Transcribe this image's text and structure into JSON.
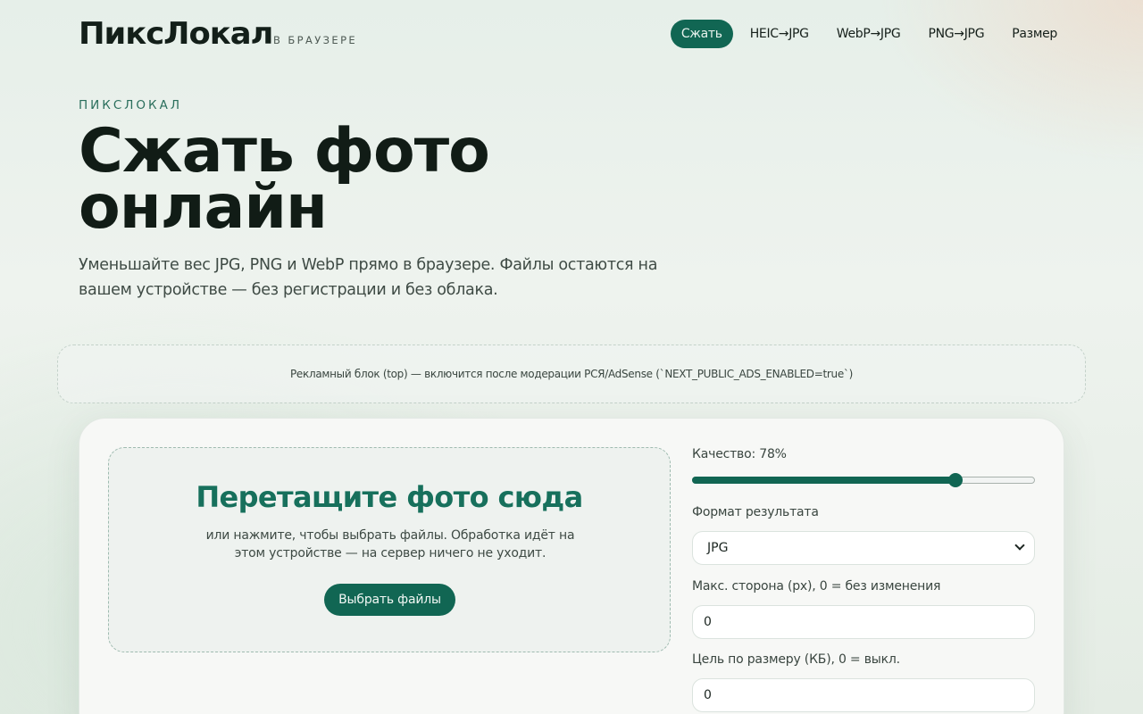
{
  "header": {
    "logo": "ПиксЛокал",
    "logo_sub": "В БРАУЗЕРЕ",
    "nav": [
      {
        "label": "Сжать",
        "active": true
      },
      {
        "label": "HEIC→JPG",
        "active": false
      },
      {
        "label": "WebP→JPG",
        "active": false
      },
      {
        "label": "PNG→JPG",
        "active": false
      },
      {
        "label": "Размер",
        "active": false
      }
    ]
  },
  "hero": {
    "eyebrow": "ПИКСЛОКАЛ",
    "title": "Сжать фото онлайн",
    "subtitle": "Уменьшайте вес JPG, PNG и WebP прямо в браузере. Файлы остаются на вашем устройстве — без регистрации и без облака."
  },
  "ad": {
    "text": "Рекламный блок (top) — включится после модерации РСЯ/AdSense (`NEXT_PUBLIC_ADS_ENABLED=true`)"
  },
  "dropzone": {
    "title": "Перетащите фото сюда",
    "subtitle": "или нажмите, чтобы выбрать файлы. Обработка идёт на этом устройстве — на сервер ничего не уходит.",
    "button": "Выбрать файлы"
  },
  "controls": {
    "quality_label": "Качество: 78%",
    "quality_value": 78,
    "format_label": "Формат результата",
    "format_value": "JPG",
    "max_side_label": "Макс. сторона (px), 0 = без изменения",
    "max_side_value": "0",
    "target_size_label": "Цель по размеру (КБ), 0 = выкл.",
    "target_size_value": "0"
  },
  "colors": {
    "accent": "#116653",
    "heading_accent": "#17705c"
  }
}
